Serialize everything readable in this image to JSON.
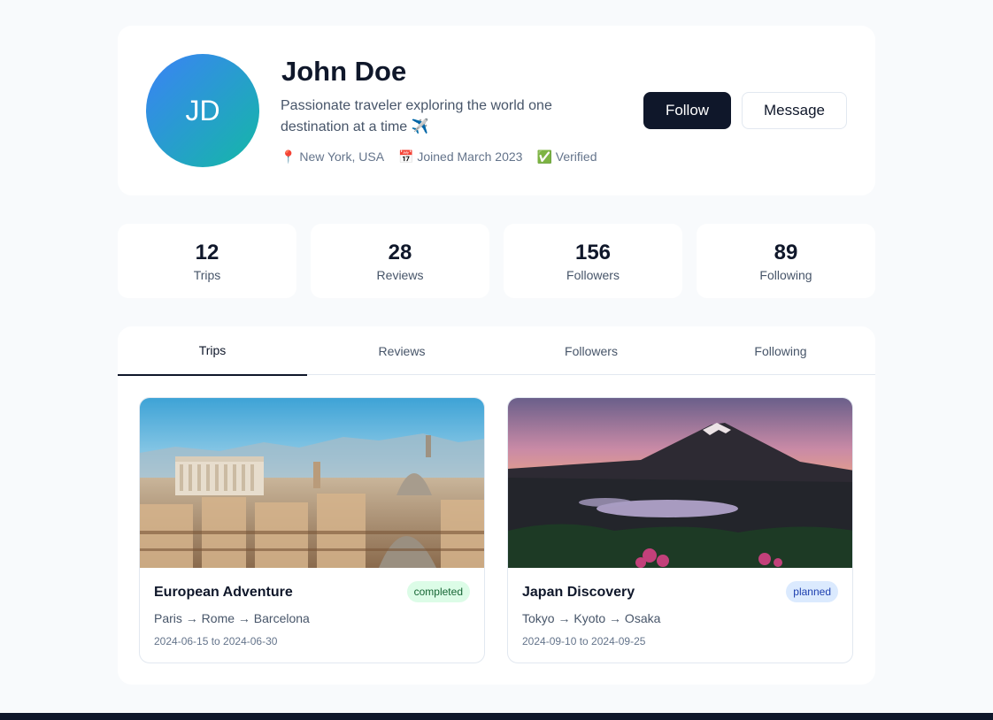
{
  "profile": {
    "initials": "JD",
    "name": "John Doe",
    "bio": "Passionate traveler exploring the world one destination at a time ✈️",
    "location": "New York, USA",
    "joined": "Joined March 2023",
    "verified": "Verified",
    "location_icon": "📍",
    "joined_icon": "📅",
    "verified_icon": "✅",
    "follow_label": "Follow",
    "message_label": "Message"
  },
  "stats": [
    {
      "value": "12",
      "label": "Trips"
    },
    {
      "value": "28",
      "label": "Reviews"
    },
    {
      "value": "156",
      "label": "Followers"
    },
    {
      "value": "89",
      "label": "Following"
    }
  ],
  "tabs": [
    {
      "label": "Trips",
      "active": true
    },
    {
      "label": "Reviews",
      "active": false
    },
    {
      "label": "Followers",
      "active": false
    },
    {
      "label": "Following",
      "active": false
    }
  ],
  "trips": [
    {
      "title": "European Adventure",
      "status": "completed",
      "route": "Paris → Rome → Barcelona",
      "dates": "2024-06-15 to 2024-06-30",
      "image": "rome-cityscape"
    },
    {
      "title": "Japan Discovery",
      "status": "planned",
      "route": "Tokyo → Kyoto → Osaka",
      "dates": "2024-09-10 to 2024-09-25",
      "image": "mount-fuji-sunset"
    }
  ],
  "colors": {
    "primary": "#0f172a",
    "avatar_start": "#3b82f6",
    "avatar_end": "#14b8a6",
    "completed_bg": "#dcfce7",
    "planned_bg": "#dbeafe"
  }
}
